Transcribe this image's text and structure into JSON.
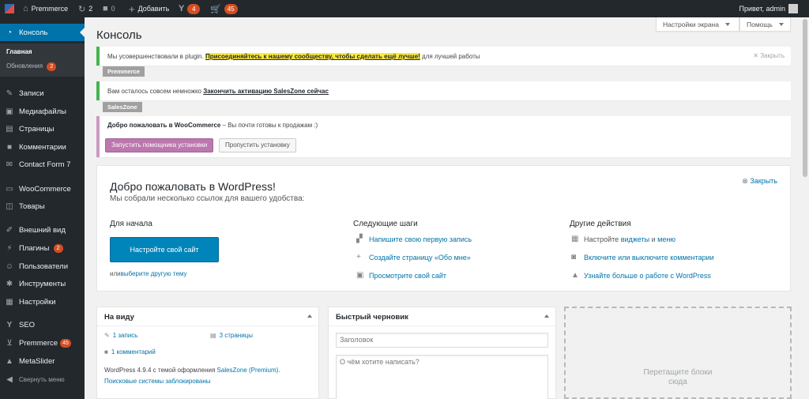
{
  "adminbar": {
    "site_name": "Premmerce",
    "updates_count": "2",
    "comments_count": "0",
    "add_new": "Добавить",
    "yoast_count": "4",
    "cart_count": "45",
    "greeting": "Привет, admin"
  },
  "sidebar": {
    "items": [
      {
        "label": "Консоль"
      },
      {
        "label": "Записи"
      },
      {
        "label": "Медиафайлы"
      },
      {
        "label": "Страницы"
      },
      {
        "label": "Комментарии"
      },
      {
        "label": "Contact Form 7"
      },
      {
        "label": "WooCommerce"
      },
      {
        "label": "Товары"
      },
      {
        "label": "Внешний вид"
      },
      {
        "label": "Плагины",
        "badge": "2"
      },
      {
        "label": "Пользователи"
      },
      {
        "label": "Инструменты"
      },
      {
        "label": "Настройки"
      },
      {
        "label": "SEO"
      },
      {
        "label": "Premmerce",
        "badge": "45"
      },
      {
        "label": "MetaSlider"
      },
      {
        "label": "Свернуть меню"
      }
    ],
    "submenu": {
      "home": "Главная",
      "updates": "Обновления",
      "updates_badge": "2"
    }
  },
  "screen_options": "Настройки экрана",
  "help": "Помощь",
  "page_title": "Консоль",
  "notice_premmerce": {
    "text_before": "Мы усовершенствовали в plugin. ",
    "link": "Присоединяйтесь к нашему сообществу, чтобы сделать ещё лучше!",
    "text_after": " для лучшей работы",
    "dismiss": "Закрыть",
    "tag": "Premmerce"
  },
  "notice_saleszone": {
    "text_before": "Вам осталось совсем немножко ",
    "link": "Закончить активацию SalesZone сейчас",
    "tag": "SalesZone"
  },
  "notice_woo": {
    "bold": "Добро пожаловать в WooCommerce",
    "text": " – Вы почти готовы к продажам :)",
    "run_wizard": "Запустить помощника установки",
    "skip": "Пропустить установку"
  },
  "welcome": {
    "title": "Добро пожаловать в WordPress!",
    "subtitle": "Мы собрали несколько ссылок для вашего удобства:",
    "dismiss": "Закрыть",
    "col1_title": "Для начала",
    "customize_btn": "Настройте свой сайт",
    "or_text": "или ",
    "change_theme": "выберите другую тему",
    "col2_title": "Следующие шаги",
    "next1": "Напишите свою первую запись",
    "next2": "Создайте страницу «Обо мне»",
    "next3": "Просмотрите свой сайт",
    "col3_title": "Другие действия",
    "more1_pre": "Настройте ",
    "more1_a": "виджеты",
    "more1_mid": " и ",
    "more1_b": "меню",
    "more2": "Включите или выключите комментарии",
    "more3": "Узнайте больше о работе с WordPress"
  },
  "at_glance": {
    "title": "На виду",
    "posts": "1 запись",
    "pages": "3 страницы",
    "comments": "1 комментарий",
    "theme_pre": "WordPress 4.9.4 с темой оформления ",
    "theme_link": "SalesZone (Premium).",
    "search_blocked": "Поисковые системы заблокированы"
  },
  "quick_draft": {
    "title": "Быстрый черновик",
    "title_placeholder": "Заголовок",
    "content_placeholder": "О чём хотите написать?"
  },
  "drop_zone": {
    "line1": "Перетащите блоки",
    "line2": "сюда"
  }
}
